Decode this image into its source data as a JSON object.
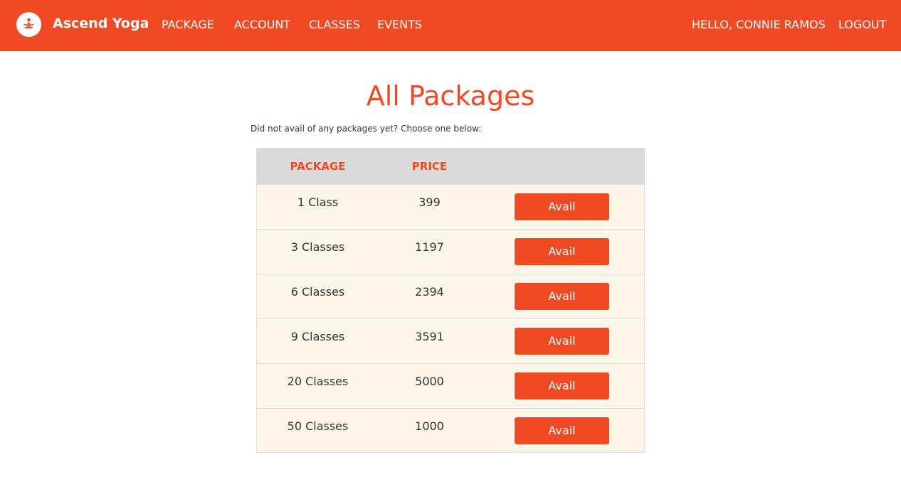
{
  "header": {
    "logo_icon": "meditating-figure-icon",
    "brand": "Ascend Yoga",
    "nav": {
      "package": "PACKAGE",
      "account": "ACCOUNT",
      "classes": "CLASSES",
      "events": "EVENTS"
    },
    "greeting": "HELLO, CONNIE RAMOS",
    "logout": "LOGOUT"
  },
  "main": {
    "title": "All Packages",
    "subtitle": "Did not avail of any packages yet? Choose one below:",
    "table": {
      "columns": [
        "PACKAGE",
        "PRICE",
        ""
      ],
      "rows": [
        {
          "package": "1 Class",
          "price": "399",
          "action": "Avail"
        },
        {
          "package": "3 Classes",
          "price": "1197",
          "action": "Avail"
        },
        {
          "package": "6 Classes",
          "price": "2394",
          "action": "Avail"
        },
        {
          "package": "9 Classes",
          "price": "3591",
          "action": "Avail"
        },
        {
          "package": "20 Classes",
          "price": "5000",
          "action": "Avail"
        },
        {
          "package": "50 Classes",
          "price": "1000",
          "action": "Avail"
        }
      ]
    }
  },
  "colors": {
    "brand": "#f04a24",
    "header_row_bg": "#dadada",
    "table_bg": "#fdf6e9",
    "text": "#333333"
  }
}
